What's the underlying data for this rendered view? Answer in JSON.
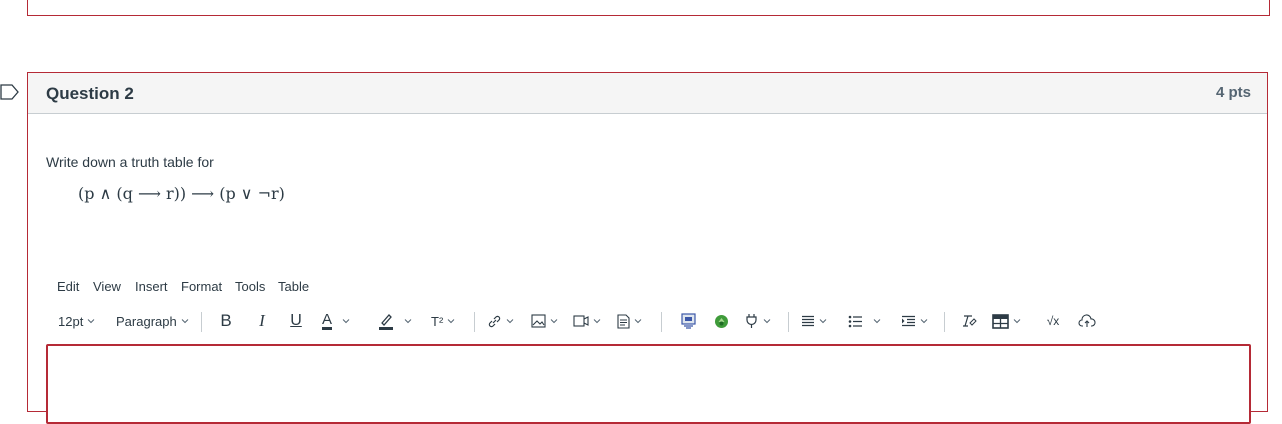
{
  "question": {
    "title": "Question 2",
    "points": "4 pts",
    "prompt": "Write down a truth table for",
    "formula": "(p ∧ (q ⟶ r)) ⟶ (p ∨ ¬r)"
  },
  "menu": [
    "Edit",
    "View",
    "Insert",
    "Format",
    "Tools",
    "Table"
  ],
  "toolbar": {
    "font_size": "12pt",
    "block_format": "Paragraph",
    "bold": "B",
    "italic": "I",
    "underline": "U",
    "text_color": "A",
    "superscript": "T²",
    "equation": "√x"
  },
  "colors": {
    "accent_border": "#b52a36",
    "text": "#2d3b45",
    "header_bg": "#f5f5f5"
  }
}
